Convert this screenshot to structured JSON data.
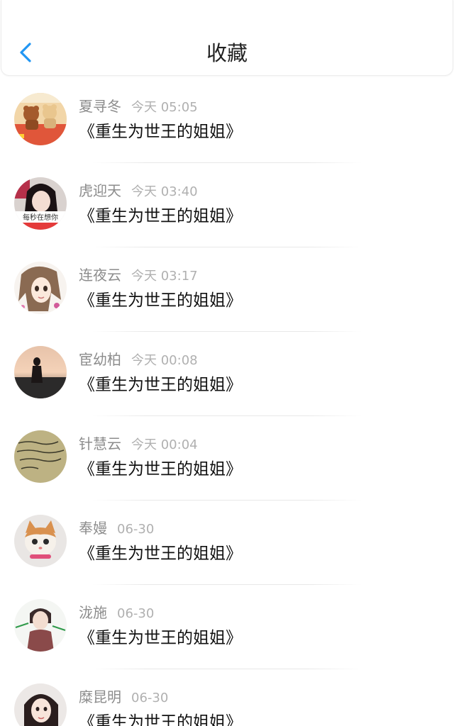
{
  "header": {
    "title": "收藏",
    "back_icon": "chevron-left-icon",
    "accent_color": "#2196f3"
  },
  "items": [
    {
      "name": "夏寻冬",
      "time": "今天 05:05",
      "book": "《重生为世王的姐姐》",
      "avatar": "avatar-image"
    },
    {
      "name": "虎迎天",
      "time": "今天 03:40",
      "book": "《重生为世王的姐姐》",
      "avatar": "avatar-image",
      "avatar_caption": "每秒在想你"
    },
    {
      "name": "连夜云",
      "time": "今天 03:17",
      "book": "《重生为世王的姐姐》",
      "avatar": "avatar-image"
    },
    {
      "name": "宦幼柏",
      "time": "今天 00:08",
      "book": "《重生为世王的姐姐》",
      "avatar": "avatar-image"
    },
    {
      "name": "针慧云",
      "time": "今天 00:04",
      "book": "《重生为世王的姐姐》",
      "avatar": "avatar-image"
    },
    {
      "name": "奉嫚",
      "time": "06-30",
      "book": "《重生为世王的姐姐》",
      "avatar": "avatar-image"
    },
    {
      "name": "泷施",
      "time": "06-30",
      "book": "《重生为世王的姐姐》",
      "avatar": "avatar-image"
    },
    {
      "name": "糜昆明",
      "time": "06-30",
      "book": "《重生为世王的姐姐》",
      "avatar": "avatar-image"
    }
  ]
}
